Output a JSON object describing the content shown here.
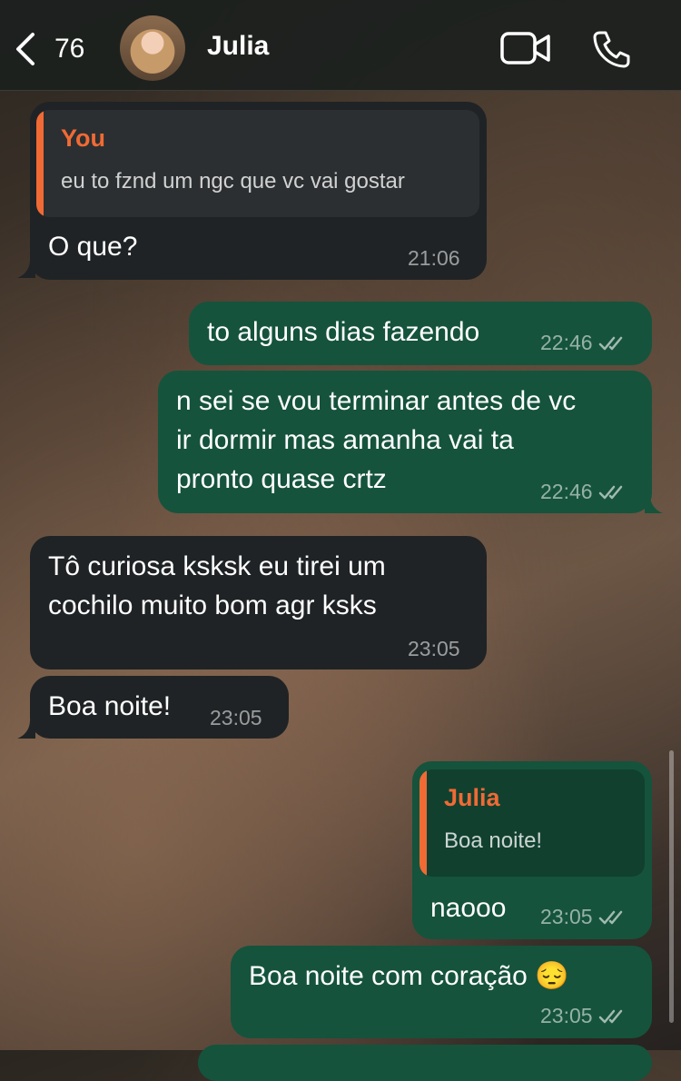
{
  "header": {
    "back_count": "76",
    "contact_name": "Julia",
    "video_icon": "video-camera-icon",
    "call_icon": "phone-icon"
  },
  "messages": [
    {
      "direction": "in",
      "quote": {
        "author": "You",
        "text": "eu to fznd um ngc que vc vai gostar"
      },
      "text": "O que?",
      "time": "21:06"
    },
    {
      "direction": "out",
      "text": "to alguns dias fazendo",
      "time": "22:46",
      "status": "read"
    },
    {
      "direction": "out",
      "lines": [
        "n sei se vou terminar antes de vc",
        "ir dormir mas amanha vai ta",
        "pronto quase crtz"
      ],
      "time": "22:46",
      "status": "read"
    },
    {
      "direction": "in",
      "lines": [
        "Tô curiosa ksksk eu tirei um",
        "cochilo muito bom agr ksks"
      ],
      "time": "23:05"
    },
    {
      "direction": "in",
      "text": "Boa noite!",
      "time": "23:05"
    },
    {
      "direction": "out",
      "quote": {
        "author": "Julia",
        "text": "Boa noite!"
      },
      "text": "naooo",
      "time": "23:05",
      "status": "read"
    },
    {
      "direction": "out",
      "text": "Boa noite com coração 😔",
      "time": "23:05",
      "status": "read"
    }
  ],
  "colors": {
    "incoming_bubble": "#1f2325",
    "outgoing_bubble": "#15533c",
    "quote_accent": "#f06a35"
  }
}
